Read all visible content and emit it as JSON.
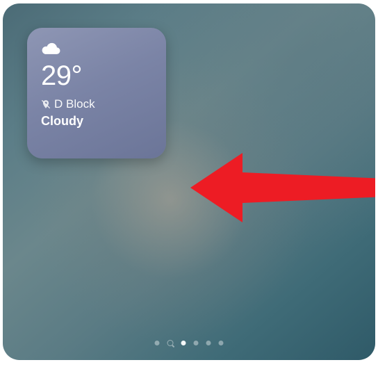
{
  "weather": {
    "temperature": "29°",
    "location": "D Block",
    "condition": "Cloudy"
  },
  "pagination": {
    "total": 6,
    "active_index": 2
  },
  "annotation": {
    "arrow_color": "#ED1C24"
  }
}
